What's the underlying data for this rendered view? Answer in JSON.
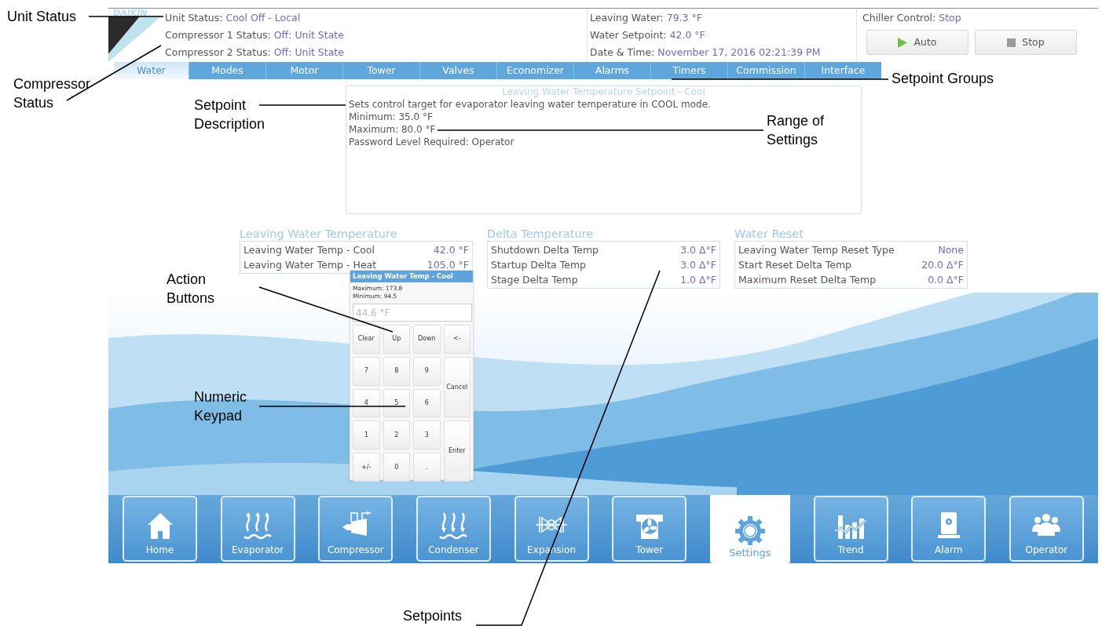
{
  "annotations": [
    {
      "text": "Unit Status"
    },
    {
      "text": "Compressor Status"
    },
    {
      "text": "Setpoint Description"
    },
    {
      "text": "Range of Settings"
    },
    {
      "text": "Setpoint Groups"
    },
    {
      "text": "Action Buttons"
    },
    {
      "text": "Numeric Keypad"
    },
    {
      "text": "Setpoints"
    }
  ],
  "header": {
    "logo": "DAIKIN",
    "status": [
      {
        "label": "Unit Status:",
        "value": "Cool Off - Local"
      },
      {
        "label": "Compressor 1 Status:",
        "value": "Off: Unit State"
      },
      {
        "label": "Compressor 2 Status:",
        "value": "Off: Unit State"
      }
    ],
    "readings": [
      {
        "label": "Leaving Water:",
        "value": "79.3 °F"
      },
      {
        "label": "Water Setpoint:",
        "value": "42.0 °F"
      },
      {
        "label": "Date & Time:",
        "value": "November 17, 2016  02:21:39 PM"
      }
    ],
    "chiller_control": {
      "label": "Chiller Control:",
      "value": "Stop"
    },
    "buttons": [
      {
        "label": "Auto",
        "kind": "play"
      },
      {
        "label": "Stop",
        "kind": "stop"
      }
    ]
  },
  "tabs": [
    {
      "label": "Water",
      "selected": true
    },
    {
      "label": "Modes",
      "selected": false
    },
    {
      "label": "Motor",
      "selected": false
    },
    {
      "label": "Tower",
      "selected": false
    },
    {
      "label": "Valves",
      "selected": false
    },
    {
      "label": "Economizer",
      "selected": false
    },
    {
      "label": "Alarms",
      "selected": false
    },
    {
      "label": "Timers",
      "selected": false
    },
    {
      "label": "Commission",
      "selected": false
    },
    {
      "label": "Interface",
      "selected": false
    }
  ],
  "description": {
    "title": "Leaving Water Temperature Setpoint - Cool",
    "lines": [
      "Sets control target for evaporator leaving water temperature in COOL mode.",
      "Minimum: 35.0 °F",
      "Maximum: 80.0 °F",
      "Password Level Required: Operator"
    ]
  },
  "groups": [
    {
      "title": "Leaving Water Temperature",
      "rows": [
        {
          "label": "Leaving Water Temp - Cool",
          "value": "42.0 °F"
        },
        {
          "label": "Leaving Water Temp - Heat",
          "value": "105.0 °F"
        }
      ]
    },
    {
      "title": "Delta Temperature",
      "rows": [
        {
          "label": "Shutdown Delta Temp",
          "value": "3.0 Δ°F"
        },
        {
          "label": "Startup Delta Temp",
          "value": "3.0 Δ°F"
        },
        {
          "label": "Stage Delta Temp",
          "value": "1.0 Δ°F"
        }
      ]
    },
    {
      "title": "Water Reset",
      "rows": [
        {
          "label": "Leaving Water Temp Reset Type",
          "value": "None"
        },
        {
          "label": "Start Reset Delta Temp",
          "value": "20.0 Δ°F"
        },
        {
          "label": "Maximum Reset Delta Temp",
          "value": "0.0 Δ°F"
        }
      ]
    }
  ],
  "keypad": {
    "title": "Leaving Water Temp - Cool",
    "maximum": "Maximum: 173.8",
    "minimum": "Minimum: 94.5",
    "placeholder": "44.6 °F",
    "keys": [
      {
        "label": "Clear",
        "kind": "key"
      },
      {
        "label": "Up",
        "kind": "key"
      },
      {
        "label": "Down",
        "kind": "key"
      },
      {
        "label": "<-",
        "kind": "key"
      },
      {
        "label": "7",
        "kind": "key"
      },
      {
        "label": "8",
        "kind": "key"
      },
      {
        "label": "9",
        "kind": "key"
      },
      {
        "label": "Cancel",
        "kind": "tall"
      },
      {
        "label": "4",
        "kind": "key"
      },
      {
        "label": "5",
        "kind": "key"
      },
      {
        "label": "6",
        "kind": "key"
      },
      {
        "label": "1",
        "kind": "key"
      },
      {
        "label": "2",
        "kind": "key"
      },
      {
        "label": "3",
        "kind": "key"
      },
      {
        "label": "Enter",
        "kind": "tall"
      },
      {
        "label": "+/-",
        "kind": "key"
      },
      {
        "label": "0",
        "kind": "key"
      },
      {
        "label": ".",
        "kind": "key"
      }
    ]
  },
  "nav": [
    {
      "label": "Home",
      "selected": false
    },
    {
      "label": "Evaporator",
      "selected": false
    },
    {
      "label": "Compressor",
      "selected": false
    },
    {
      "label": "Condenser",
      "selected": false
    },
    {
      "label": "Expansion",
      "selected": false
    },
    {
      "label": "Tower",
      "selected": false
    },
    {
      "label": "Settings",
      "selected": true
    },
    {
      "label": "Trend",
      "selected": false
    },
    {
      "label": "Alarm",
      "selected": false
    },
    {
      "label": "Operator",
      "selected": false
    }
  ]
}
